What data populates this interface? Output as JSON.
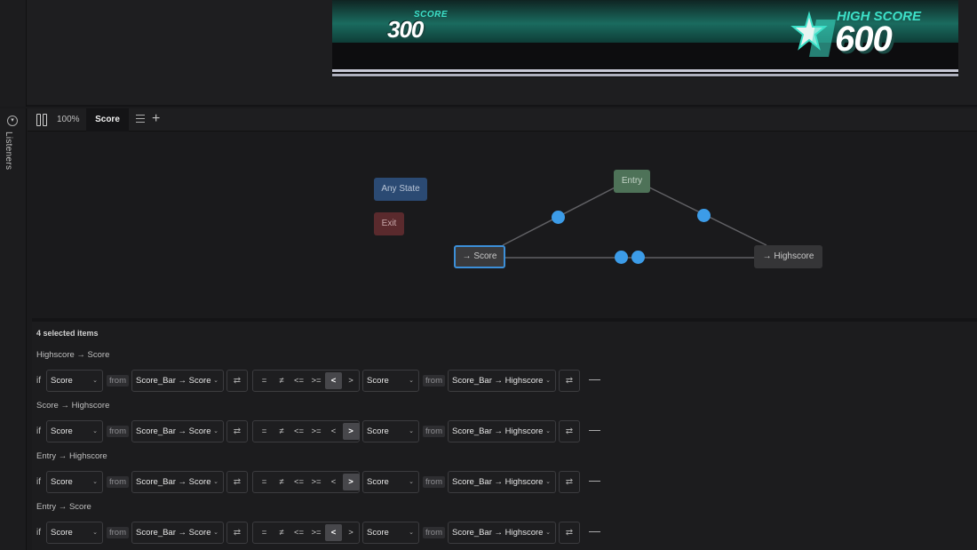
{
  "preview": {
    "score_caption": "SCORE",
    "score_value": "300",
    "high_caption": "HIGH SCORE",
    "high_value": "600"
  },
  "sidebar": {
    "listeners_label": "Listeners"
  },
  "tabbar": {
    "zoom": "100%",
    "active_tab": "Score"
  },
  "graph": {
    "nodes": {
      "any_state": "Any State",
      "exit": "Exit",
      "entry": "Entry",
      "score": "→ Score",
      "highscore": "→ Highscore"
    }
  },
  "inspector": {
    "selected_count": "4 selected items",
    "if_word": "if",
    "from_word": "from",
    "operators": [
      "=",
      "≠",
      "<=",
      ">=",
      "<",
      ">"
    ],
    "transitions": [
      {
        "label": "Highscore → Score",
        "left_input": "Score",
        "left_source": "Score_Bar → Score",
        "active_op": "<",
        "right_input": "Score",
        "right_source": "Score_Bar → Highscore"
      },
      {
        "label": "Score → Highscore",
        "left_input": "Score",
        "left_source": "Score_Bar → Score",
        "active_op": ">",
        "right_input": "Score",
        "right_source": "Score_Bar → Highscore"
      },
      {
        "label": "Entry → Highscore",
        "left_input": "Score",
        "left_source": "Score_Bar → Score",
        "active_op": ">",
        "right_input": "Score",
        "right_source": "Score_Bar → Highscore"
      },
      {
        "label": "Entry → Score",
        "left_input": "Score",
        "left_source": "Score_Bar → Score",
        "active_op": "<",
        "right_input": "Score",
        "right_source": "Score_Bar → Highscore"
      }
    ]
  },
  "colors": {
    "accent": "#3c9ce8",
    "teal": "#3de0c8"
  }
}
